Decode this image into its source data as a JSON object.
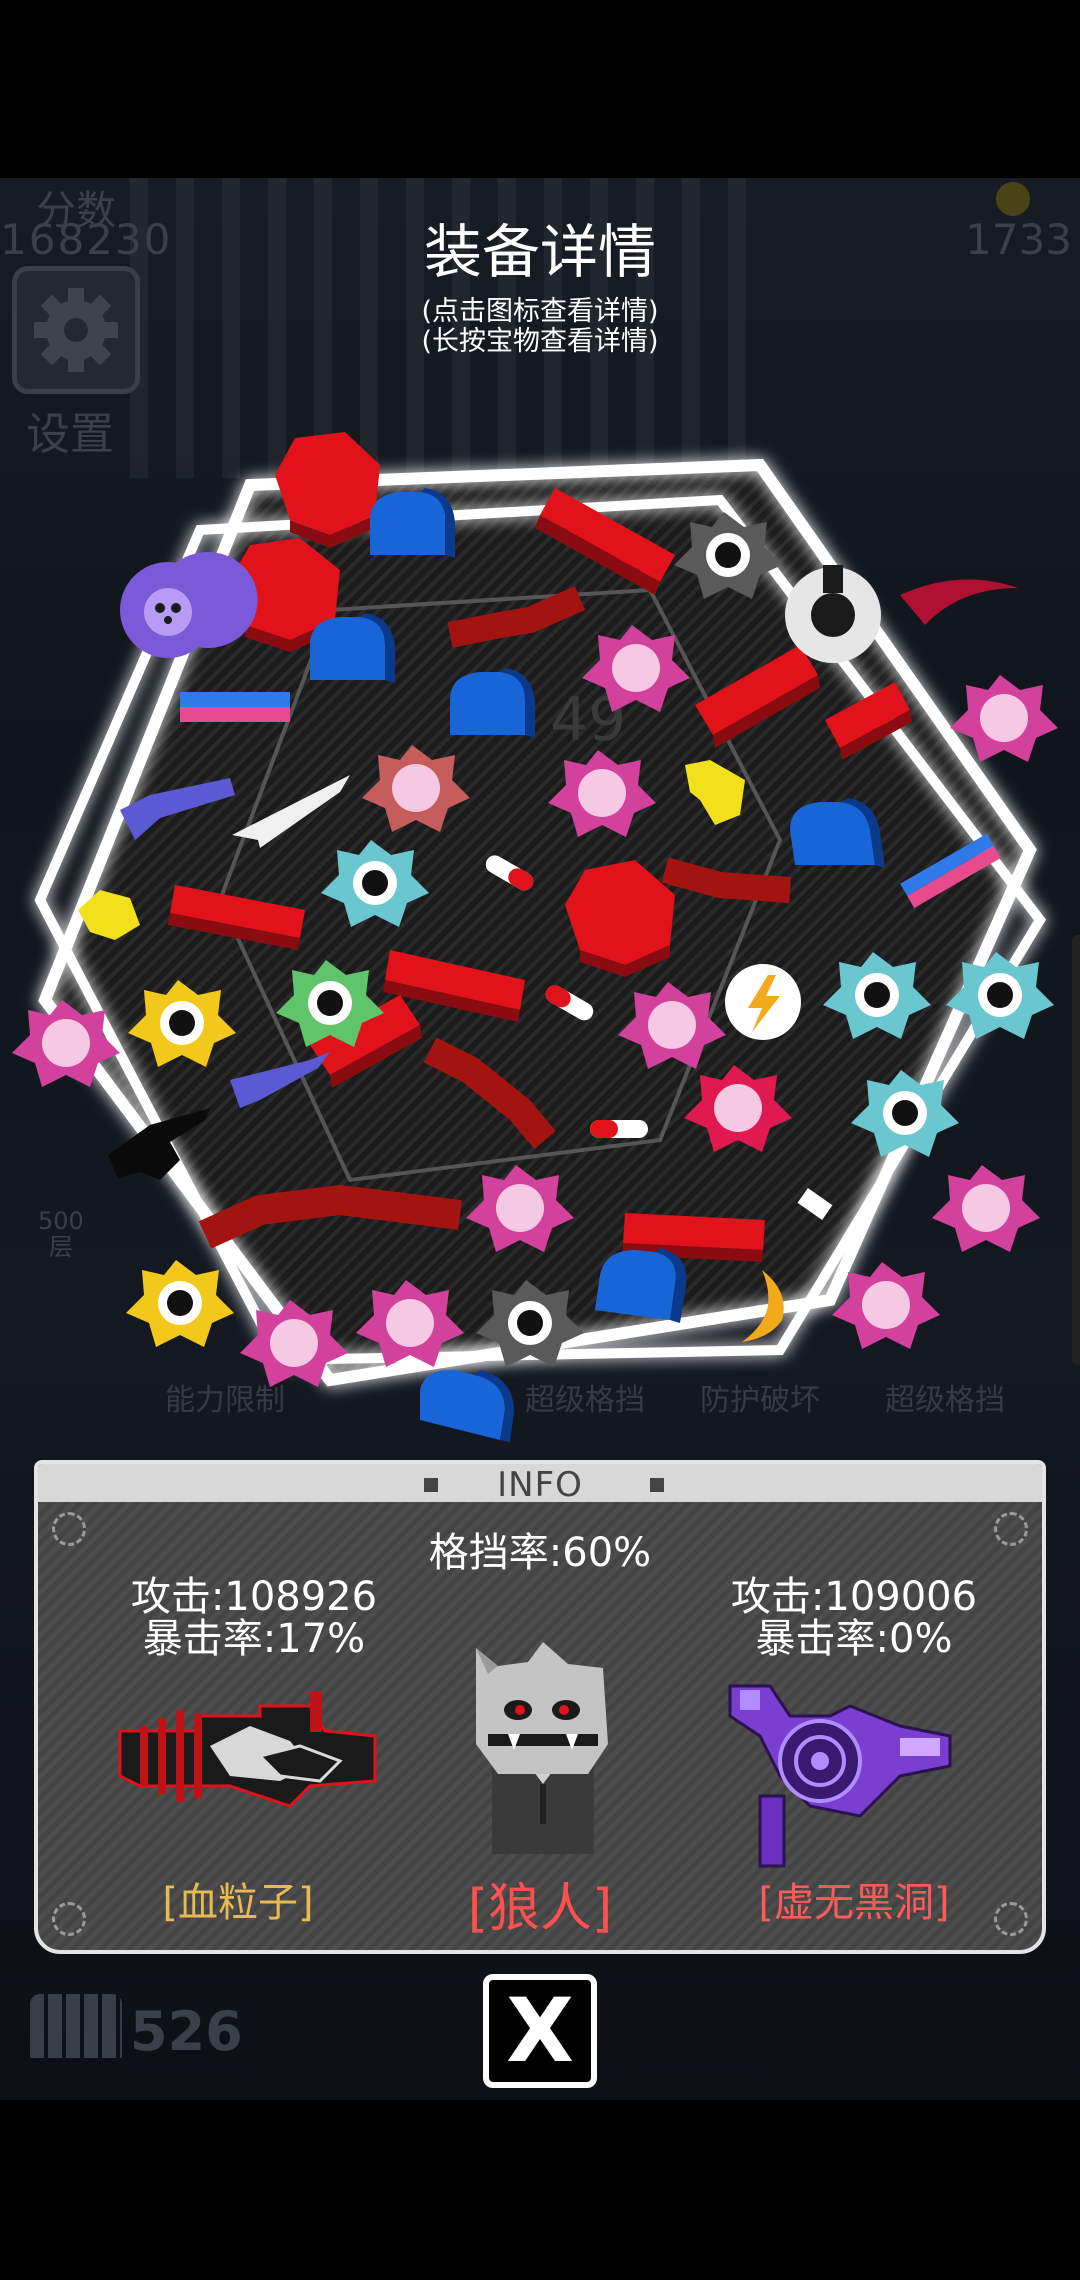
{
  "title": "装备详情",
  "hints": [
    "(点击图标查看详情)",
    "(长按宝物查看详情)"
  ],
  "background": {
    "score_label": "分数",
    "score_value": "168230",
    "coins_value": "1733",
    "settings_label": "设置",
    "center_text": "49",
    "floor_value": "500",
    "floor_unit": "层",
    "skills": [
      "能力限制",
      "超级格挡",
      "防护破坏",
      "超级格挡"
    ],
    "ammo_value": "526"
  },
  "info": {
    "header": "INFO",
    "block_rate": "格挡率:60%",
    "left_weapon": {
      "attack": "攻击:108926",
      "crit": "暴击率:17%",
      "name": "[血粒子]",
      "name_color": "#e7bb52"
    },
    "right_weapon": {
      "attack": "攻击:109006",
      "crit": "暴击率:0%",
      "name": "[虚无黑洞]",
      "name_color": "#ff5a5a"
    },
    "character": {
      "name": "[狼人]"
    }
  },
  "close_label": "X",
  "colors": {
    "red": "#e11219",
    "blue": "#1765d6",
    "pink": "#d2429c",
    "border": "#ffffff"
  }
}
